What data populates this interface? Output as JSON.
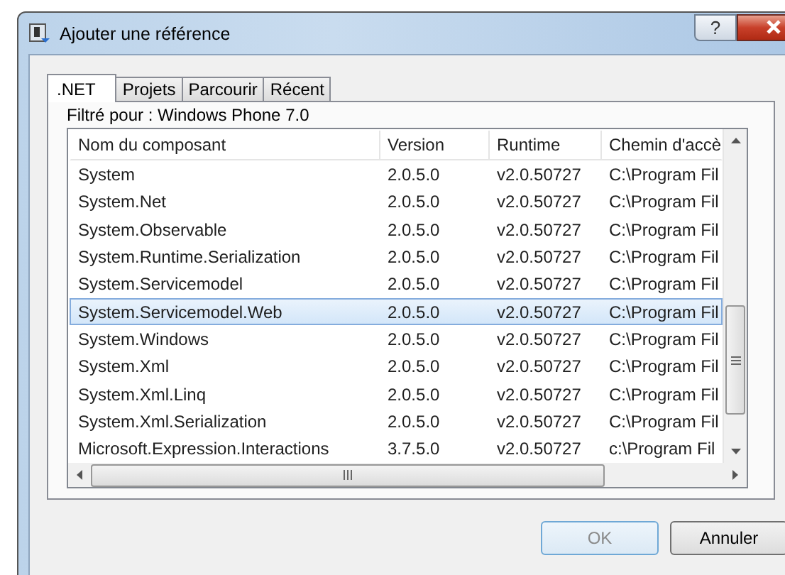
{
  "window": {
    "title": "Ajouter une référence",
    "help_button": "?"
  },
  "tabs": [
    {
      "label": ".NET",
      "selected": true
    },
    {
      "label": "Projets",
      "selected": false
    },
    {
      "label": "Parcourir",
      "selected": false
    },
    {
      "label": "Récent",
      "selected": false
    }
  ],
  "filter_label": "Filtré pour : Windows Phone 7.0",
  "table": {
    "columns": [
      "Nom du composant",
      "Version",
      "Runtime",
      "Chemin d'accè"
    ],
    "rows": [
      {
        "cells": [
          "System",
          "2.0.5.0",
          "v2.0.50727",
          "C:\\Program Fil"
        ],
        "selected": false
      },
      {
        "cells": [
          "System.Net",
          "2.0.5.0",
          "v2.0.50727",
          "C:\\Program Fil"
        ],
        "selected": false
      },
      {
        "cells": [
          "System.Observable",
          "2.0.5.0",
          "v2.0.50727",
          "C:\\Program Fil"
        ],
        "selected": false
      },
      {
        "cells": [
          "System.Runtime.Serialization",
          "2.0.5.0",
          "v2.0.50727",
          "C:\\Program Fil"
        ],
        "selected": false
      },
      {
        "cells": [
          "System.Servicemodel",
          "2.0.5.0",
          "v2.0.50727",
          "C:\\Program Fil"
        ],
        "selected": false
      },
      {
        "cells": [
          "System.Servicemodel.Web",
          "2.0.5.0",
          "v2.0.50727",
          "C:\\Program Fil"
        ],
        "selected": true
      },
      {
        "cells": [
          "System.Windows",
          "2.0.5.0",
          "v2.0.50727",
          "C:\\Program Fil"
        ],
        "selected": false
      },
      {
        "cells": [
          "System.Xml",
          "2.0.5.0",
          "v2.0.50727",
          "C:\\Program Fil"
        ],
        "selected": false
      },
      {
        "cells": [
          "System.Xml.Linq",
          "2.0.5.0",
          "v2.0.50727",
          "C:\\Program Fil"
        ],
        "selected": false
      },
      {
        "cells": [
          "System.Xml.Serialization",
          "2.0.5.0",
          "v2.0.50727",
          "C:\\Program Fil"
        ],
        "selected": false
      },
      {
        "cells": [
          "Microsoft.Expression.Interactions",
          "3.7.5.0",
          "v2.0.50727",
          "c:\\Program Fil"
        ],
        "selected": false
      }
    ]
  },
  "buttons": [
    {
      "label": "OK",
      "disabled": true
    },
    {
      "label": "Annuler",
      "disabled": false
    }
  ]
}
